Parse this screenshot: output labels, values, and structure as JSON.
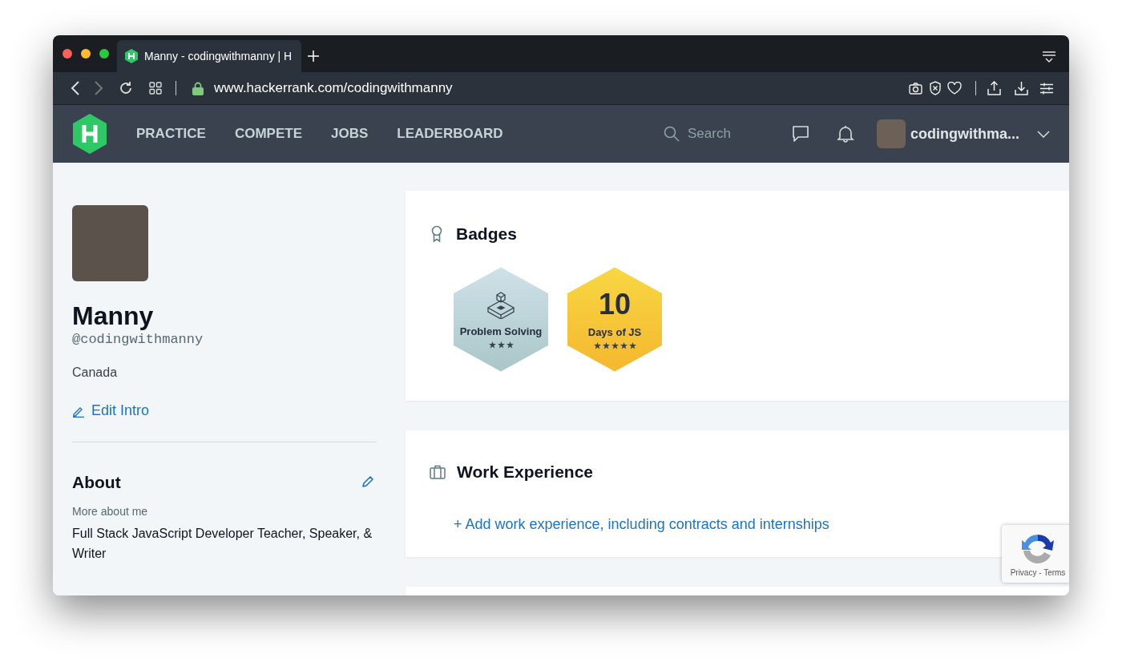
{
  "browser": {
    "tab": {
      "title": "Manny - codingwithmanny | H",
      "selected": true
    },
    "url": "www.hackerrank.com/codingwithmanny"
  },
  "nav": {
    "items": [
      "PRACTICE",
      "COMPETE",
      "JOBS",
      "LEADERBOARD"
    ],
    "search": {
      "placeholder": "Search"
    },
    "username": "codingwithma..."
  },
  "profile": {
    "name": "Manny",
    "handle": "@codingwithmanny",
    "country": "Canada",
    "edit_link": "Edit Intro"
  },
  "about": {
    "title": "About",
    "label": "More about me",
    "text": "Full Stack JavaScript Developer Teacher, Speaker, & Writer"
  },
  "badges": {
    "title": "Badges",
    "items": [
      {
        "kind": "icon",
        "name": "Problem Solving",
        "stars": 3
      },
      {
        "kind": "number",
        "number": "10",
        "name": "Days of JS",
        "stars": 5
      }
    ]
  },
  "work_experience": {
    "title": "Work Experience",
    "add_link": "+ Add work experience, including contracts and internships"
  },
  "recaptcha": {
    "links": "Privacy - Terms"
  }
}
